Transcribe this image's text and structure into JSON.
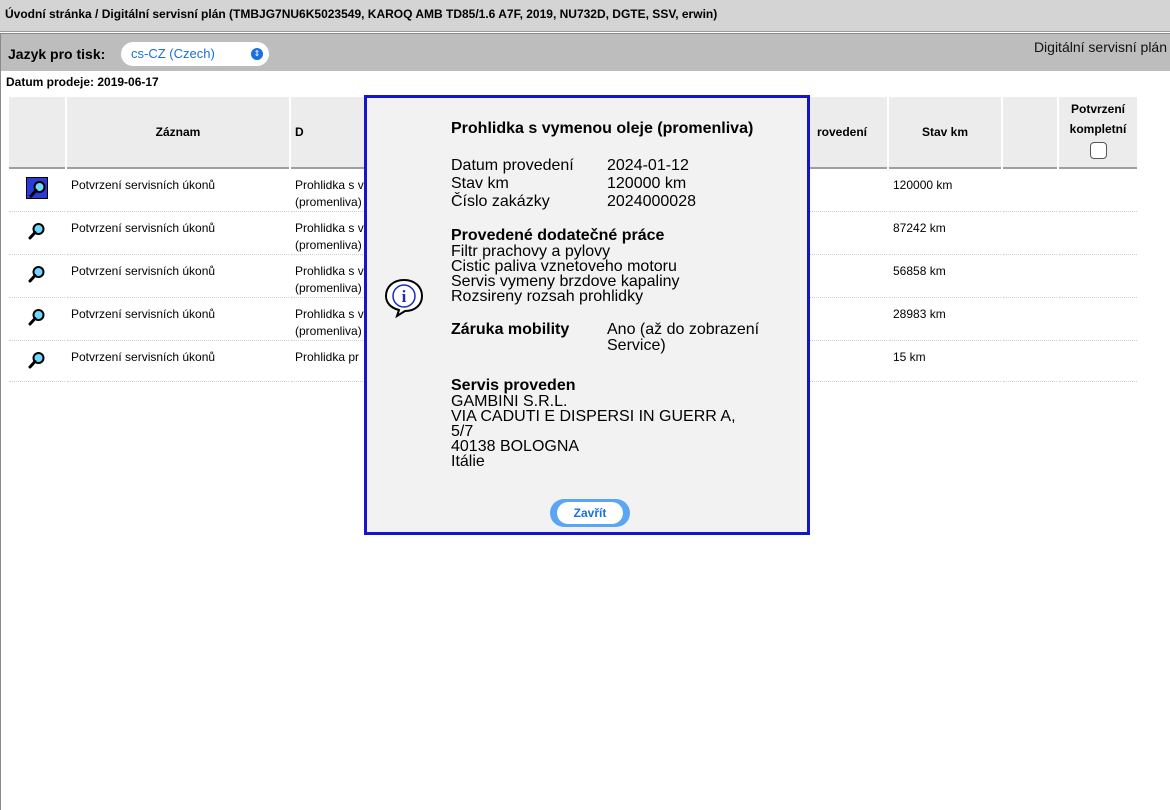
{
  "titlebar": {
    "text": "Úvodní stránka / Digitální servisní plán (TMBJG7NU6K5023549, KAROQ AMB TD85/1.6 A7F, 2019, NU732D, DGTE, SSV, erwin)"
  },
  "toolbar": {
    "language_label": "Jazyk pro tisk:",
    "language_value": "cs-CZ (Czech)",
    "page_heading": "Digitální servisní plán"
  },
  "sale_date": "Datum prodeje: 2019-06-17",
  "table": {
    "headers": {
      "record": "Záznam",
      "desc_partial": "D",
      "date_partial": "rovedení",
      "km": "Stav km",
      "confirm_line1": "Potvrzení",
      "confirm_line2": "kompletní"
    },
    "rows": [
      {
        "record": "Potvrzení servisních úkonů",
        "desc1": "Prohlidka s v",
        "desc2": "(promenliva)",
        "km": "120000 km"
      },
      {
        "record": "Potvrzení servisních úkonů",
        "desc1": "Prohlidka s v",
        "desc2": "(promenliva)",
        "km": "87242 km"
      },
      {
        "record": "Potvrzení servisních úkonů",
        "desc1": "Prohlidka s v",
        "desc2": "(promenliva)",
        "km": "56858 km"
      },
      {
        "record": "Potvrzení servisních úkonů",
        "desc1": "Prohlidka s v",
        "desc2": "(promenliva)",
        "km": "28983 km"
      },
      {
        "record": "Potvrzení servisních úkonů",
        "desc1": "Prohlidka pr",
        "desc2": "",
        "km": "15 km"
      }
    ]
  },
  "modal": {
    "title": "Prohlidka s vymenou oleje (promenliva)",
    "date_label": "Datum provedení",
    "date_value": "2024-01-12",
    "km_label": "Stav km",
    "km_value": "120000 km",
    "order_label": "Číslo zakázky",
    "order_value": "2024000028",
    "extra_work_title": "Provedené dodatečné práce",
    "extra_work": [
      "Filtr prachovy a pylovy",
      "Cistic paliva vznetoveho motoru",
      "Servis vymeny brzdove kapaliny",
      "Rozsireny rozsah prohlidky"
    ],
    "mobility_label": "Záruka mobility",
    "mobility_value_1": "Ano (až do zobrazení",
    "mobility_value_2": "Service)",
    "service_title": "Servis proveden",
    "service_lines": [
      "GAMBINI S.R.L.",
      "VIA CADUTI E DISPERSI IN GUERR A,",
      "5/7",
      "40138 BOLOGNA",
      "Itálie"
    ],
    "close_label": "Zavřít"
  },
  "colors": {
    "modal_border": "#1515cc",
    "accent": "#1a6fe0",
    "toolbar": "#bdbdbd"
  }
}
